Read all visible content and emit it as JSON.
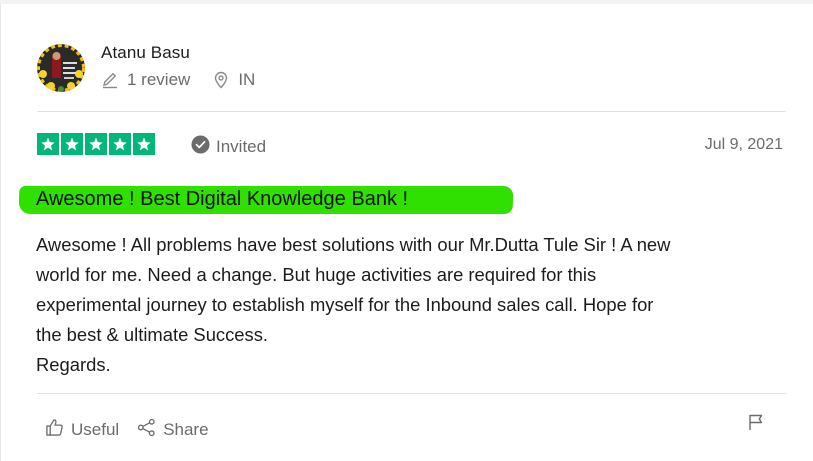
{
  "reviewer": {
    "name": "Atanu Basu",
    "review_count": "1 review",
    "country": "IN"
  },
  "rating": {
    "stars": 5,
    "max_stars": 5,
    "star_color": "#00b67a"
  },
  "status": {
    "invited_label": "Invited"
  },
  "review": {
    "date": "Jul 9, 2021",
    "title": "Awesome ! Best Digital Knowledge Bank !",
    "title_highlight_color": "#2fe000",
    "body_lines": [
      "Awesome ! All problems have best solutions with our Mr.Dutta Tule Sir ! A new",
      "world for me. Need a change. But huge activities are required for this",
      "experimental journey to establish myself for the Inbound sales call. Hope for",
      "the best & ultimate Success.",
      "Regards."
    ]
  },
  "actions": {
    "useful_label": "Useful",
    "share_label": "Share"
  },
  "icons": {
    "edit": "pencil-icon",
    "location": "map-pin-icon",
    "invited": "check-circle-icon",
    "useful": "thumbs-up-icon",
    "share": "share-icon",
    "report": "flag-icon",
    "star": "star-icon"
  }
}
